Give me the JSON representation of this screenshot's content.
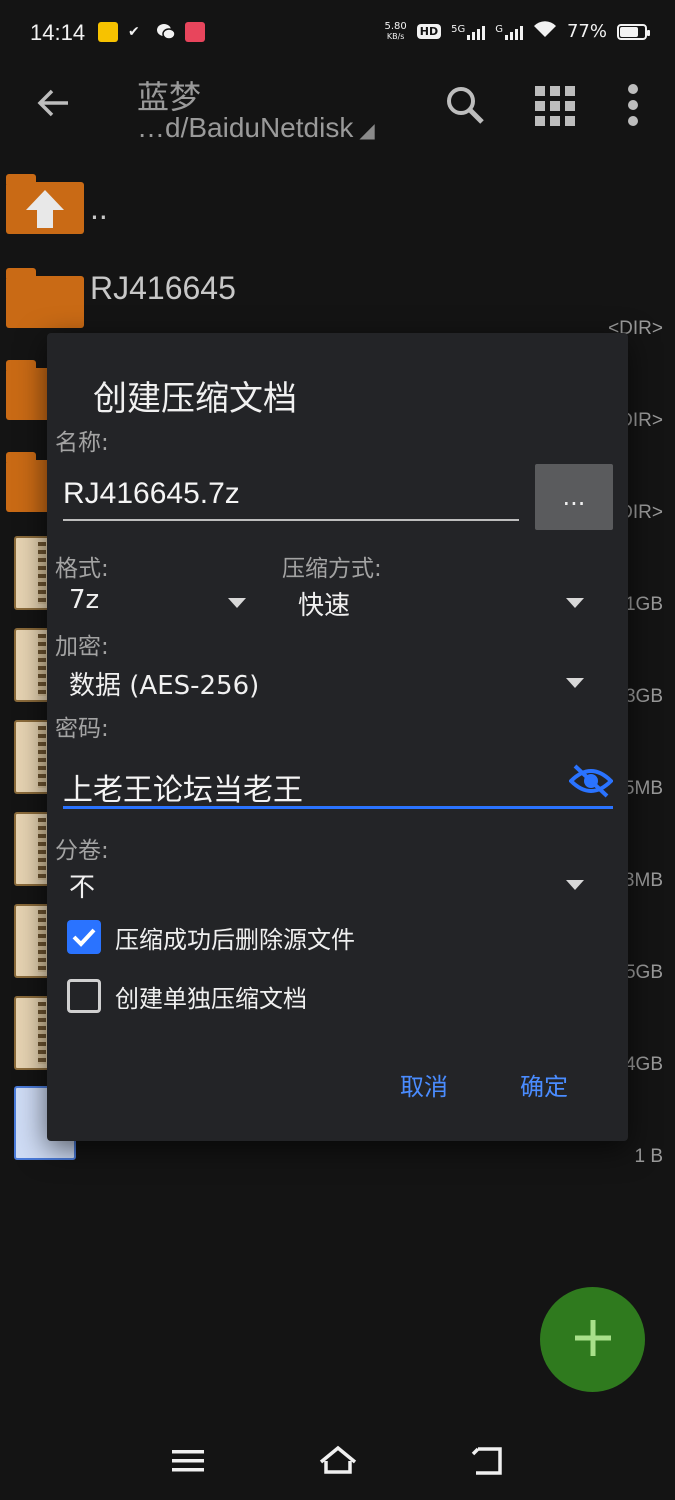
{
  "status": {
    "time": "14:14",
    "net_speed_top": "5.80",
    "net_speed_bottom": "KB/s",
    "hd": "HD",
    "sim1": "5G",
    "sim2": "G",
    "battery": "77%",
    "battery_level": 0.77
  },
  "appbar": {
    "title": "蓝梦",
    "path": "…d/BaiduNetdisk"
  },
  "list": {
    "parent": "..",
    "items": [
      {
        "name": "RJ416645",
        "meta": "<DIR>"
      },
      {
        "name": "",
        "meta": "DIR>"
      },
      {
        "name": "",
        "meta": "DIR>"
      },
      {
        "name": "",
        "meta": "1GB"
      },
      {
        "name": "",
        "meta": "3GB"
      },
      {
        "name": "",
        "meta": "5MB"
      },
      {
        "name": "",
        "meta": "3MB"
      },
      {
        "name": "",
        "meta": "5GB"
      },
      {
        "name": "",
        "meta": "4GB"
      },
      {
        "name": "",
        "meta": "1 B"
      }
    ]
  },
  "dialog": {
    "title": "创建压缩文档",
    "name_label": "名称:",
    "name_value": "RJ416645.7z",
    "more_button": "...",
    "format_label": "格式:",
    "format_value": "7z",
    "method_label": "压缩方式:",
    "method_value": "快速",
    "encrypt_label": "加密:",
    "encrypt_value": "数据 (AES-256)",
    "password_label": "密码:",
    "password_value": "上老王论坛当老王",
    "split_label": "分卷:",
    "split_value": "不",
    "delete_source_label": "压缩成功后删除源文件",
    "delete_source_checked": true,
    "separate_label": "创建单独压缩文档",
    "separate_checked": false,
    "cancel": "取消",
    "ok": "确定"
  },
  "colors": {
    "accent": "#2a73ff",
    "folder": "#c96a15",
    "fab": "#2f7a1e"
  }
}
